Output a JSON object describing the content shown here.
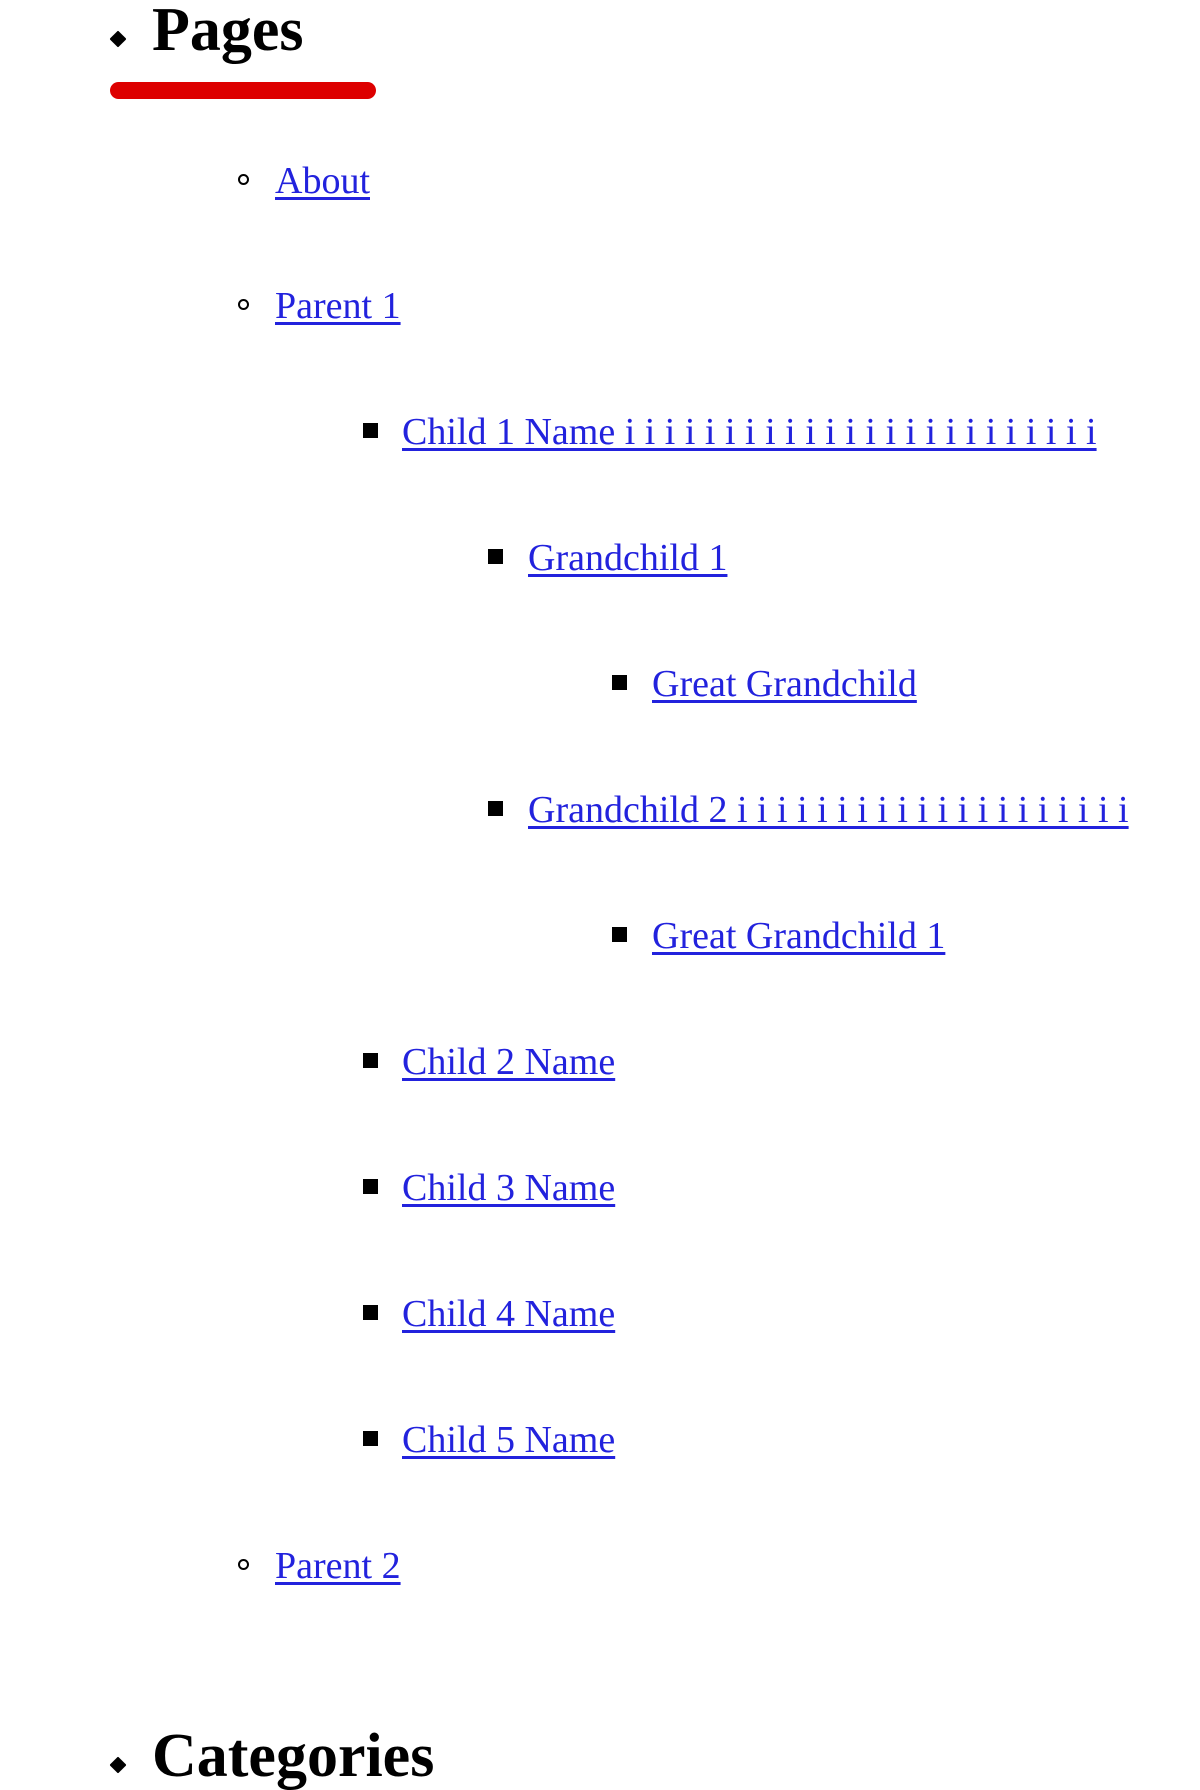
{
  "widgets": [
    {
      "title": "Pages",
      "bullet": "diamond-bullet",
      "has_rule": true,
      "rule_color": "#dd0000"
    },
    {
      "title": "Categories",
      "bullet": "diamond-bullet",
      "has_rule": false
    }
  ],
  "colors": {
    "link": "#2222dd",
    "heading": "#000000",
    "rule": "#dd0000",
    "background": "#ffffff"
  },
  "pages_tree": {
    "level2_bullet": "hollow-circle-bullet",
    "level3_bullet": "filled-square-bullet",
    "items": [
      {
        "label": "About"
      },
      {
        "label": "Parent 1"
      },
      {
        "label": "Child 1 Name i i i i i i i i i i i i i i i i i i i i i i i i"
      },
      {
        "label": "Grandchild 1"
      },
      {
        "label": "Great Grandchild"
      },
      {
        "label": "Grandchild 2 i i i i i i i i i i i i i i i i i i i i"
      },
      {
        "label": "Great Grandchild 1"
      },
      {
        "label": "Child 2 Name"
      },
      {
        "label": "Child 3 Name"
      },
      {
        "label": "Child 4 Name"
      },
      {
        "label": "Child 5 Name"
      },
      {
        "label": "Parent 2"
      }
    ]
  }
}
